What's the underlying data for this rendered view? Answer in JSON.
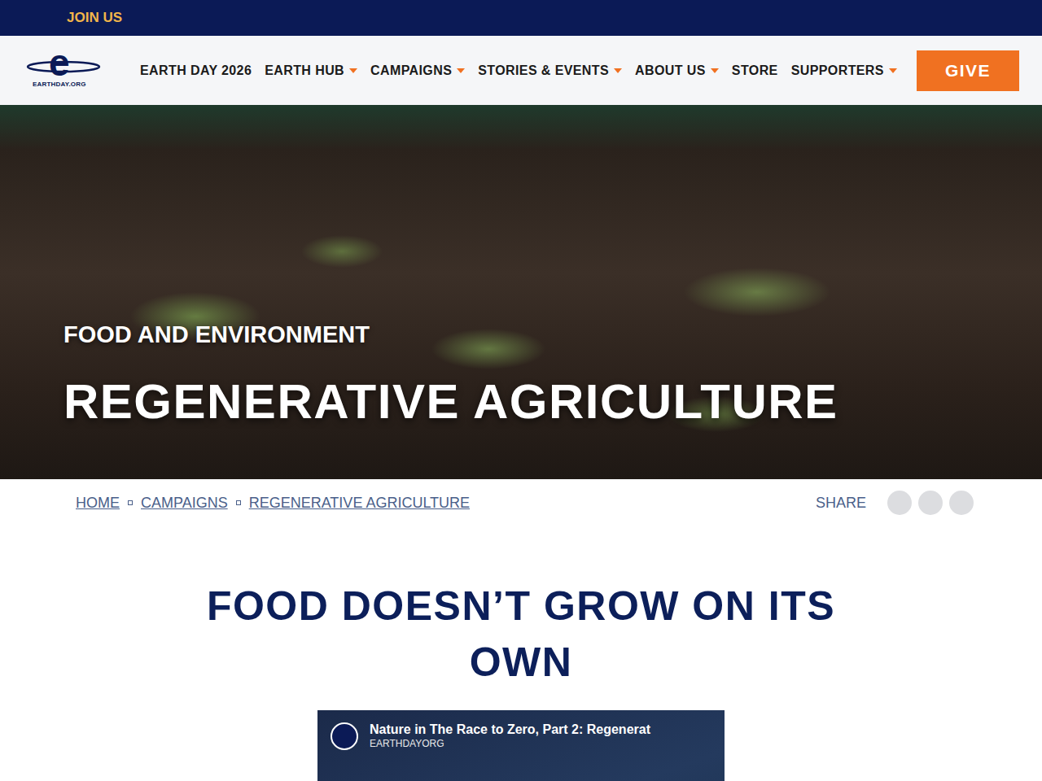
{
  "top_bar": {
    "link": "JOIN US"
  },
  "logo": {
    "mark": "e",
    "text": "EARTHDAY.ORG"
  },
  "nav": {
    "items": [
      {
        "label": "EARTH DAY 2026",
        "dropdown": false
      },
      {
        "label": "EARTH HUB",
        "dropdown": true
      },
      {
        "label": "CAMPAIGNS",
        "dropdown": true
      },
      {
        "label": "STORIES & EVENTS",
        "dropdown": true
      },
      {
        "label": "ABOUT US",
        "dropdown": true
      },
      {
        "label": "STORE",
        "dropdown": false
      },
      {
        "label": "SUPPORTERS",
        "dropdown": true
      }
    ],
    "give": "GIVE"
  },
  "hero": {
    "category": "FOOD AND ENVIRONMENT",
    "title": "REGENERATIVE AGRICULTURE"
  },
  "breadcrumb": [
    "HOME",
    "CAMPAIGNS",
    "REGENERATIVE AGRICULTURE"
  ],
  "share": {
    "label": "SHARE"
  },
  "heading": "FOOD DOESN’T GROW ON ITS OWN",
  "video": {
    "title": "Nature in The Race to Zero, Part 2: Regenerat",
    "channel": "EARTHDAYORG"
  }
}
